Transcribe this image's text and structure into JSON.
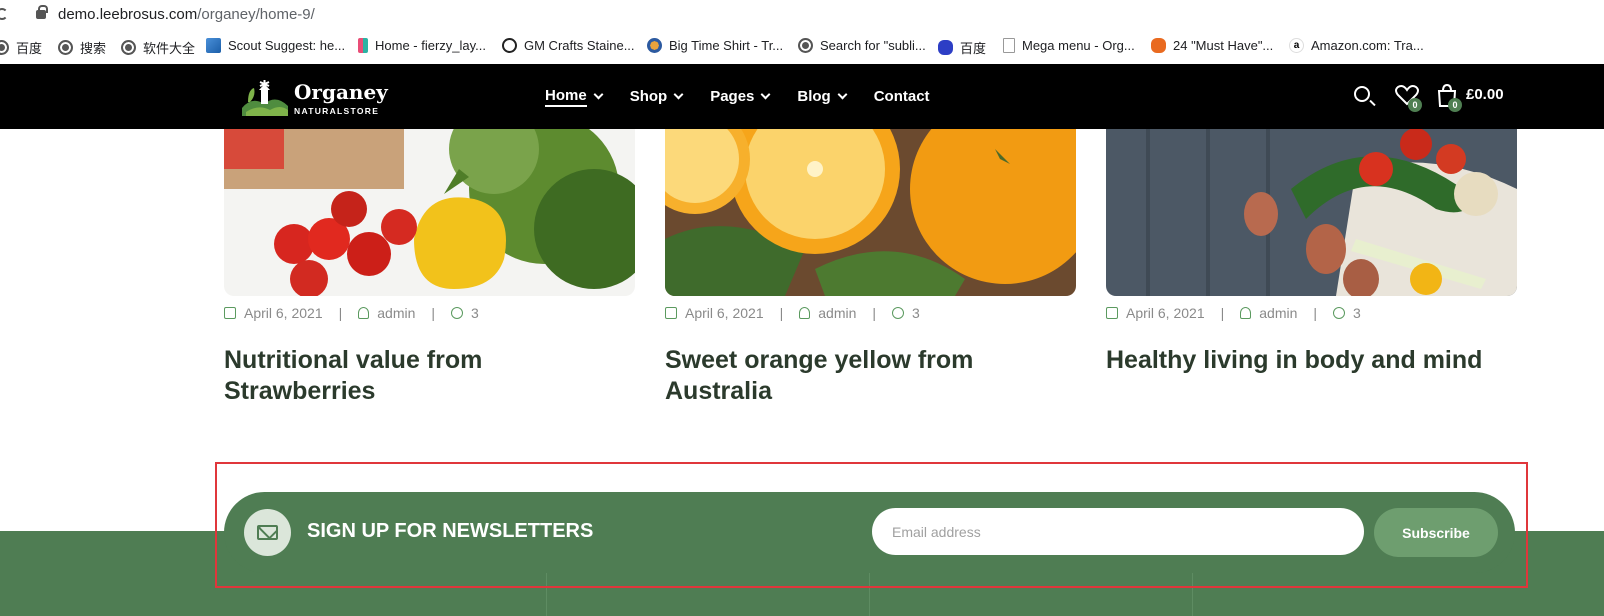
{
  "browser": {
    "url_host": "demo.leebrosus.com",
    "url_path": "/organey/home-9/",
    "bookmarks": [
      {
        "label": "百度",
        "icon": "globe-icon"
      },
      {
        "label": "搜索",
        "icon": "globe-icon"
      },
      {
        "label": "软件大全",
        "icon": "globe-icon"
      },
      {
        "label": "Scout Suggest: he...",
        "icon": "chart-icon"
      },
      {
        "label": "Home - fierzy_lay...",
        "icon": "h-icon"
      },
      {
        "label": "GM Crafts Staine...",
        "icon": "gm-icon"
      },
      {
        "label": "Big Time Shirt - Tr...",
        "icon": "tshirt-icon"
      },
      {
        "label": "Search for \"subli...",
        "icon": "globe-icon"
      },
      {
        "label": "百度",
        "icon": "paw-icon"
      },
      {
        "label": "Mega menu - Org...",
        "icon": "doc-icon"
      },
      {
        "label": "24 \"Must Have\"...",
        "icon": "mega-icon"
      },
      {
        "label": "Amazon.com: Tra...",
        "icon": "amazon-icon"
      }
    ]
  },
  "header": {
    "logo_name": "Organey",
    "logo_tagline": "NATURALSTORE",
    "nav": [
      {
        "label": "Home",
        "active": true,
        "dropdown": true
      },
      {
        "label": "Shop",
        "active": false,
        "dropdown": true
      },
      {
        "label": "Pages",
        "active": false,
        "dropdown": true
      },
      {
        "label": "Blog",
        "active": false,
        "dropdown": true
      },
      {
        "label": "Contact",
        "active": false,
        "dropdown": false
      }
    ],
    "wishlist_count": "0",
    "cart_count": "0",
    "cart_total": "£0.00"
  },
  "posts": [
    {
      "date": "April 6, 2021",
      "author": "admin",
      "comments": "3",
      "title": "Nutritional value from Strawberries"
    },
    {
      "date": "April 6, 2021",
      "author": "admin",
      "comments": "3",
      "title": "Sweet orange yellow from Australia"
    },
    {
      "date": "April 6, 2021",
      "author": "admin",
      "comments": "3",
      "title": "Healthy living in body and mind"
    }
  ],
  "newsletter": {
    "title": "SIGN UP FOR NEWSLETTERS",
    "email_placeholder": "Email address",
    "subscribe_label": "Subscribe"
  },
  "colors": {
    "brand_green": "#4f7d53",
    "accent_green": "#6e9e6f",
    "highlight_red": "#e0363b"
  }
}
